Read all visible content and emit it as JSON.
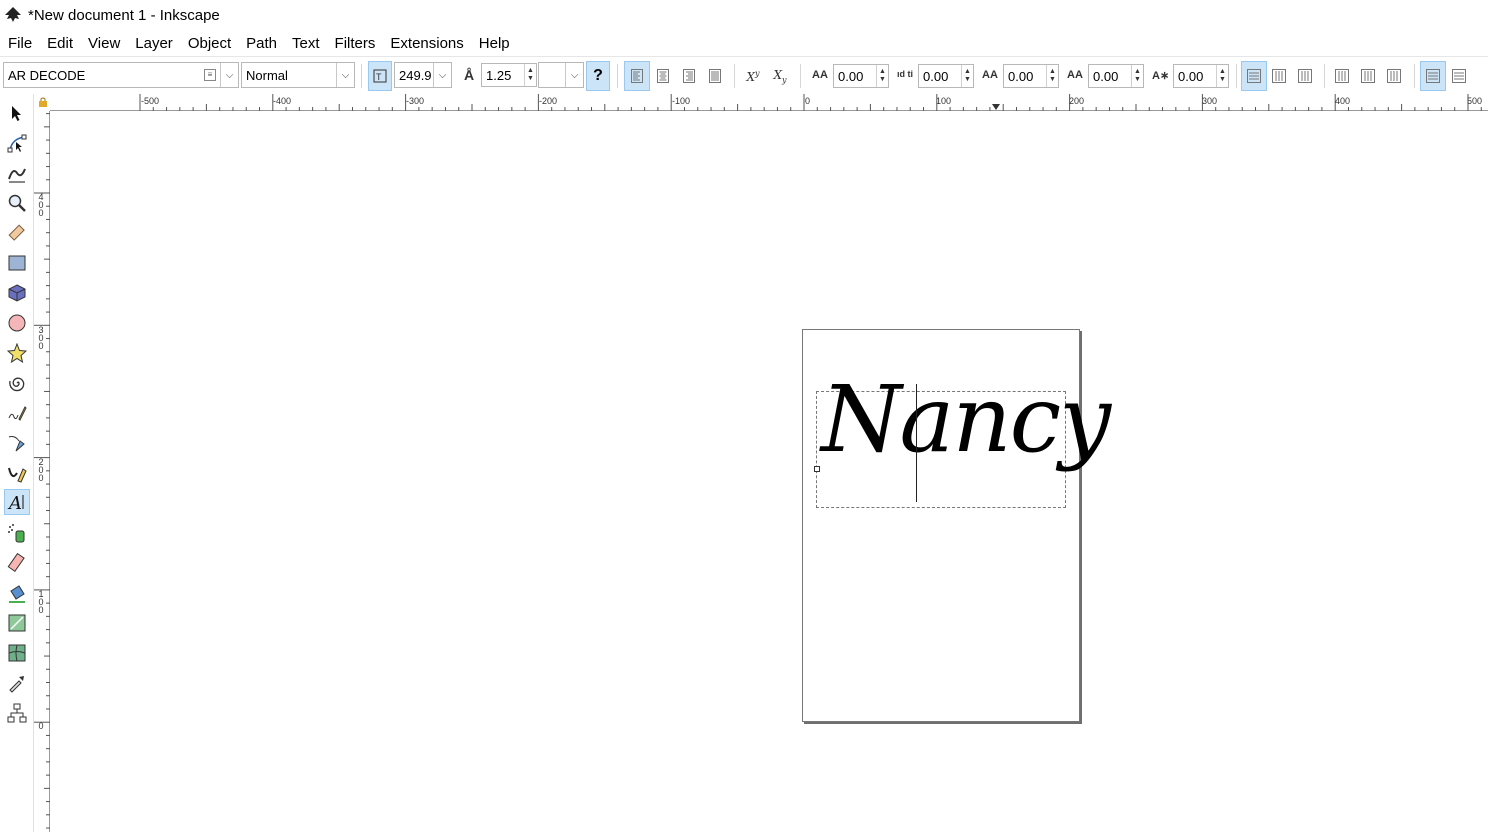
{
  "window": {
    "title": "*New document 1 - Inkscape"
  },
  "menu": [
    "File",
    "Edit",
    "View",
    "Layer",
    "Object",
    "Path",
    "Text",
    "Filters",
    "Extensions",
    "Help"
  ],
  "text_toolbar": {
    "font_family": "AR DECODE",
    "font_style": "Normal",
    "font_size": "249.9",
    "line_height": "1.25",
    "line_height_unit": "",
    "letter_spacing": "0.00",
    "word_spacing": "0.00",
    "horizontal_kern": "0.00",
    "vertical_shift": "0.00",
    "rotation": "0.00"
  },
  "hruler_labels": [
    "-500",
    "-400",
    "-300",
    "-200",
    "-100",
    "0",
    "100",
    "200",
    "300",
    "400",
    "500"
  ],
  "vruler_labels": [
    "4\n0\n0",
    "3\n0\n0",
    "2\n0\n0",
    "1\n0\n0",
    "0"
  ],
  "canvas": {
    "text": "Nancy"
  },
  "colors": {
    "active_bg": "#cce4f7",
    "active_border": "#99c9ef",
    "page_shadow": "#6f6f6f"
  },
  "tools": [
    "selector-icon",
    "node-icon",
    "tweak-icon",
    "zoom-icon",
    "measure-icon",
    "rect-icon",
    "3dbox-icon",
    "ellipse-icon",
    "star-icon",
    "spiral-icon",
    "pencil-icon",
    "pen-icon",
    "calligraphy-icon",
    "text-icon",
    "spray-icon",
    "eraser-icon",
    "bucket-icon",
    "gradient-icon",
    "mesh-icon",
    "dropper-icon",
    "connector-icon"
  ]
}
